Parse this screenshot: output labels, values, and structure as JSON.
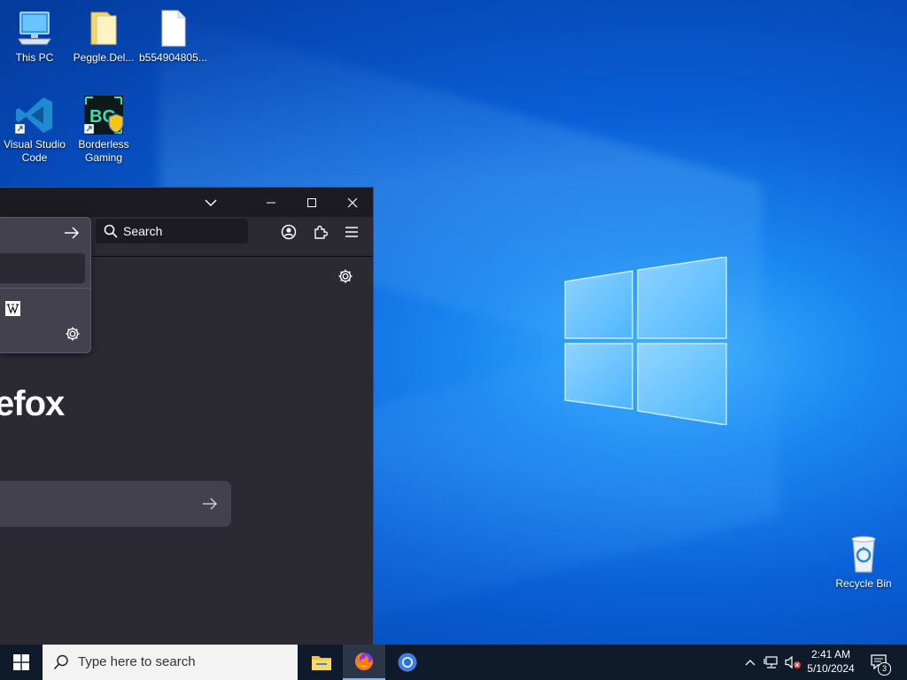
{
  "desktop": {
    "icons": [
      {
        "label": "This PC"
      },
      {
        "label": "Peggle.Del..."
      },
      {
        "label": "b554904805..."
      },
      {
        "label": "Visual Studio Code"
      },
      {
        "label": "Borderless Gaming"
      },
      {
        "label": "Recycle Bin"
      }
    ]
  },
  "browser": {
    "search_placeholder": "Search",
    "brand_fragment": "efox"
  },
  "taskbar": {
    "search_placeholder": "Type here to search",
    "clock_time": "2:41 AM",
    "clock_date": "5/10/2024",
    "notifications_count": "3"
  }
}
